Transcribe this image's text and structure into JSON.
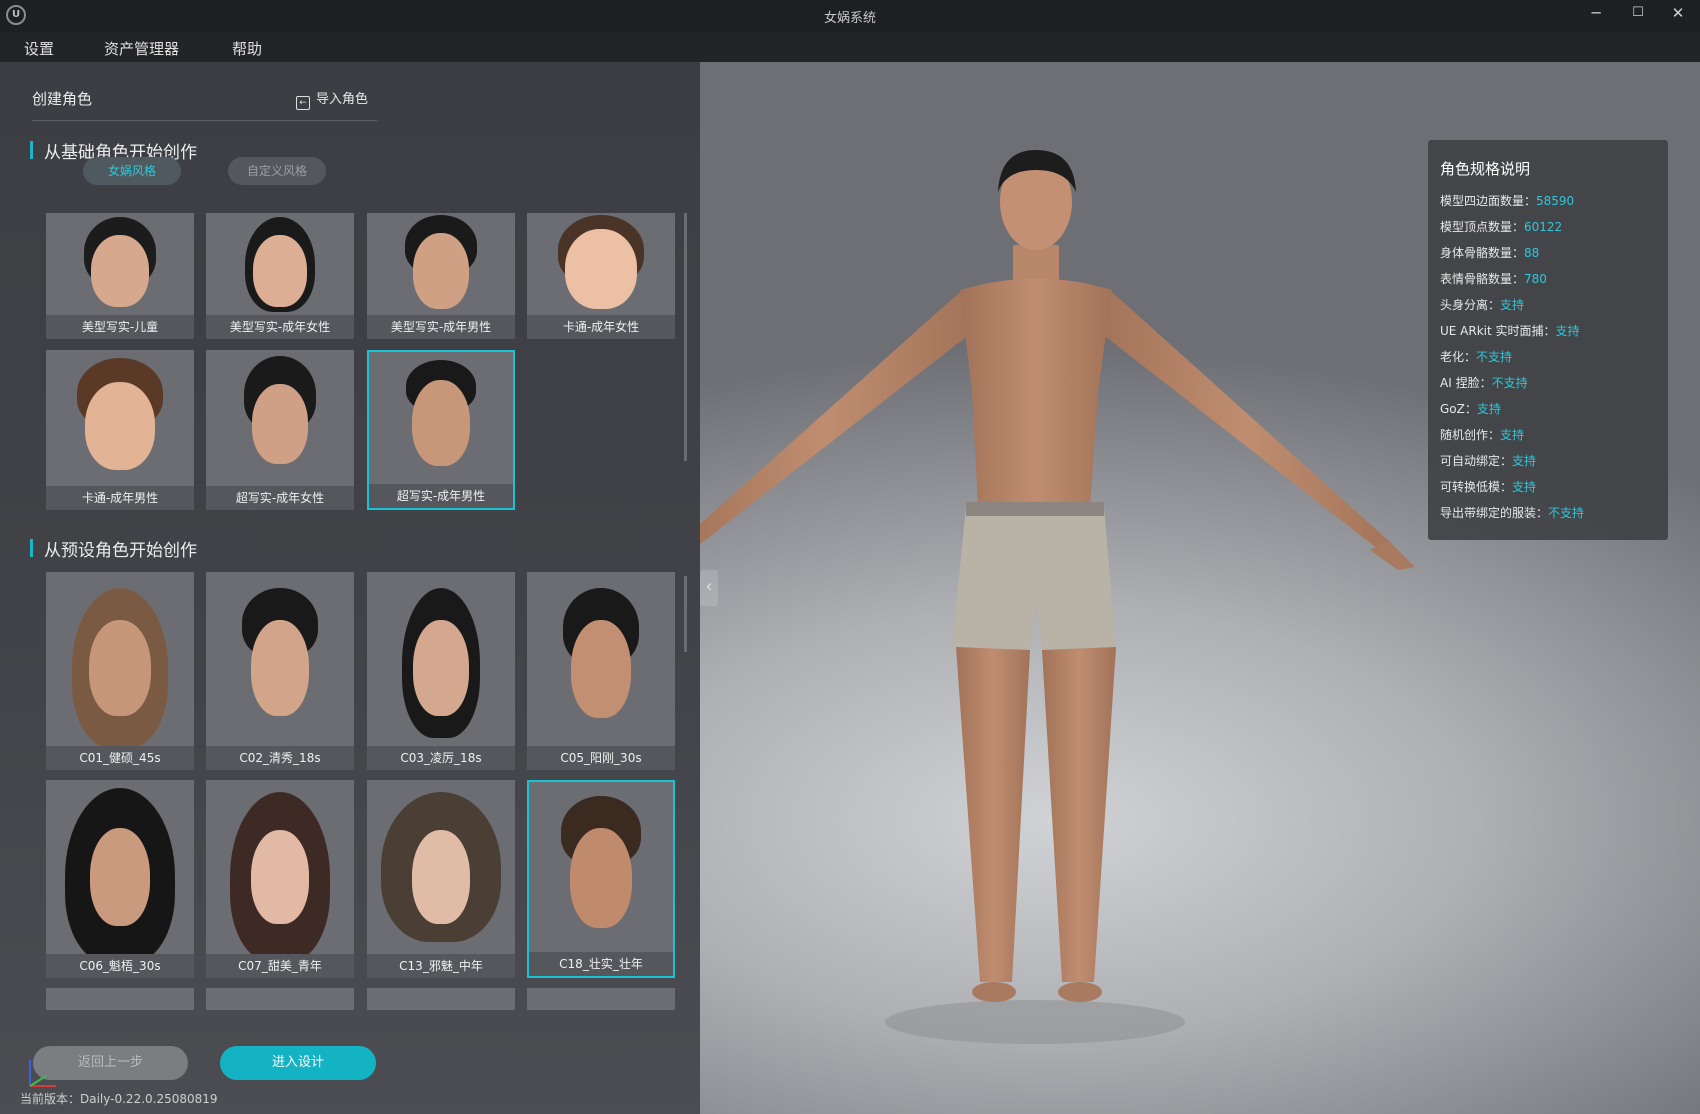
{
  "window": {
    "title": "女娲系统",
    "min": "─",
    "max": "☐",
    "close": "✕"
  },
  "menu": [
    "设置",
    "资产管理器",
    "帮助"
  ],
  "create": {
    "label": "创建角色",
    "import_label": "导入角色"
  },
  "base_section": {
    "title": "从基础角色开始创作",
    "tabs": [
      "女娲风格",
      "自定义风格"
    ],
    "cards": [
      "美型写实-儿童",
      "美型写实-成年女性",
      "美型写实-成年男性",
      "卡通-成年女性",
      "卡通-成年男性",
      "超写实-成年女性",
      "超写实-成年男性"
    ]
  },
  "preset_section": {
    "title": "从预设角色开始创作",
    "cards": [
      "C01_健硕_45s",
      "C02_清秀_18s",
      "C03_凌厉_18s",
      "C05_阳刚_30s",
      "C06_魁梧_30s",
      "C07_甜美_青年",
      "C13_邪魅_中年",
      "C18_壮实_壮年"
    ]
  },
  "buttons": {
    "back": "返回上一步",
    "enter": "进入设计"
  },
  "version": "当前版本：Daily-0.22.0.25080819",
  "collapse_icon": "‹",
  "spec": {
    "title": "角色规格说明",
    "rows": [
      {
        "k": "模型四边面数量：",
        "v": "58590"
      },
      {
        "k": "模型顶点数量：",
        "v": "60122"
      },
      {
        "k": "身体骨骼数量：",
        "v": "88"
      },
      {
        "k": "表情骨骼数量：",
        "v": "780"
      },
      {
        "k": "头身分离：",
        "v": "支持"
      },
      {
        "k": "UE ARkit 实时面捕：",
        "v": "支持"
      },
      {
        "k": "老化：",
        "v": "不支持"
      },
      {
        "k": "AI 捏脸：",
        "v": "不支持"
      },
      {
        "k": "GoZ：",
        "v": "支持"
      },
      {
        "k": "随机创作：",
        "v": "支持"
      },
      {
        "k": "可自动绑定：",
        "v": "支持"
      },
      {
        "k": "可转换低模：",
        "v": "支持"
      },
      {
        "k": "导出带绑定的服装：",
        "v": "不支持"
      }
    ]
  },
  "colors": {
    "accent": "#19c3d3",
    "spec_value": "#2ec8da"
  }
}
